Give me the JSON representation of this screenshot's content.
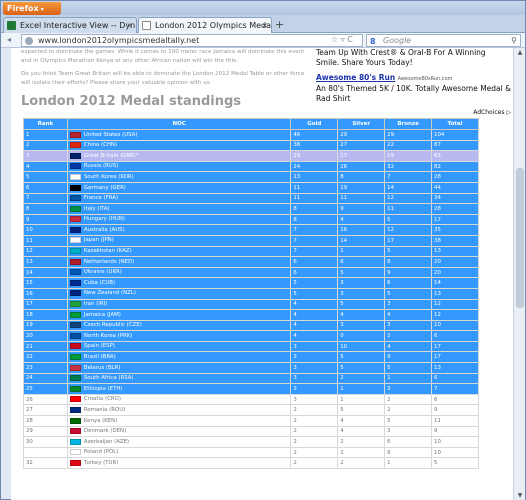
{
  "browser": {
    "app_button": "Firefox",
    "tabs": [
      {
        "title": "Excel Interactive View -- Dyn..."
      },
      {
        "title": "London 2012 Olympics Meda..."
      }
    ],
    "new_tab": "+",
    "url": "www.london2012olympicsmedaltally.net",
    "search_engine": "Google",
    "search_placeholder": "Google",
    "back": "◂",
    "star": "☆ ▿ C"
  },
  "page": {
    "intro_lines": [
      "expected to dominate the games. While it comes to 100 meter race Jamaica will dominate this event and in Olympics Marathon Kenya or any other African nation will win the title.",
      "Do you think Team Great Britain will be able to dominate the London 2012 Medal Table or other force will isolate their efforts? Please share your valuable opinion with us."
    ],
    "ad": {
      "line1": "Team Up With Crest® & Oral-B For A Winning Smile. Share Yours Today!",
      "title": "Awesome 80's Run",
      "url": "Awesome80sRun.com",
      "body": "An 80's Themed 5K / 10K. Totally Awesome Medal & Rad Shirt",
      "choices": "AdChoices ▷"
    },
    "heading": "London 2012 Medal standings",
    "table": {
      "headers": [
        "Rank",
        "NOC",
        "Gold",
        "Silver",
        "Bronze",
        "Total"
      ],
      "rows": [
        {
          "rank": "1",
          "noc": "United States (USA)",
          "gold": "46",
          "silver": "29",
          "bronze": "29",
          "total": "104",
          "style": "sel",
          "flag": "#b22234"
        },
        {
          "rank": "2",
          "noc": "China (CHN)",
          "gold": "38",
          "silver": "27",
          "bronze": "22",
          "total": "87",
          "style": "sel",
          "flag": "#de2910"
        },
        {
          "rank": "3",
          "noc": "Great Britain (GBR)*",
          "gold": "29",
          "silver": "17",
          "bronze": "19",
          "total": "65",
          "style": "hl",
          "flag": "#012169"
        },
        {
          "rank": "4",
          "noc": "Russia (RUS)",
          "gold": "24",
          "silver": "26",
          "bronze": "32",
          "total": "82",
          "style": "sel",
          "flag": "#0039a6"
        },
        {
          "rank": "5",
          "noc": "South Korea (KOR)",
          "gold": "13",
          "silver": "8",
          "bronze": "7",
          "total": "28",
          "style": "sel",
          "flag": "#ffffff"
        },
        {
          "rank": "6",
          "noc": "Germany (GER)",
          "gold": "11",
          "silver": "19",
          "bronze": "14",
          "total": "44",
          "style": "sel",
          "flag": "#000000"
        },
        {
          "rank": "7",
          "noc": "France (FRA)",
          "gold": "11",
          "silver": "11",
          "bronze": "12",
          "total": "34",
          "style": "sel",
          "flag": "#0055a4"
        },
        {
          "rank": "8",
          "noc": "Italy (ITA)",
          "gold": "8",
          "silver": "9",
          "bronze": "11",
          "total": "28",
          "style": "sel",
          "flag": "#009246"
        },
        {
          "rank": "9",
          "noc": "Hungary (HUN)",
          "gold": "8",
          "silver": "4",
          "bronze": "5",
          "total": "17",
          "style": "sel",
          "flag": "#cd2a3e"
        },
        {
          "rank": "10",
          "noc": "Australia (AUS)",
          "gold": "7",
          "silver": "16",
          "bronze": "12",
          "total": "35",
          "style": "sel",
          "flag": "#00247d"
        },
        {
          "rank": "11",
          "noc": "Japan (JPN)",
          "gold": "7",
          "silver": "14",
          "bronze": "17",
          "total": "38",
          "style": "sel",
          "flag": "#ffffff"
        },
        {
          "rank": "12",
          "noc": "Kazakhstan (KAZ)",
          "gold": "7",
          "silver": "1",
          "bronze": "5",
          "total": "13",
          "style": "sel",
          "flag": "#00afca"
        },
        {
          "rank": "13",
          "noc": "Netherlands (NED)",
          "gold": "6",
          "silver": "6",
          "bronze": "8",
          "total": "20",
          "style": "sel",
          "flag": "#ae1c28"
        },
        {
          "rank": "14",
          "noc": "Ukraine (UKR)",
          "gold": "6",
          "silver": "5",
          "bronze": "9",
          "total": "20",
          "style": "sel",
          "flag": "#0057b7"
        },
        {
          "rank": "15",
          "noc": "Cuba (CUB)",
          "gold": "5",
          "silver": "3",
          "bronze": "6",
          "total": "14",
          "style": "sel",
          "flag": "#002a8f"
        },
        {
          "rank": "16",
          "noc": "New Zealand (NZL)",
          "gold": "5",
          "silver": "3",
          "bronze": "5",
          "total": "13",
          "style": "sel",
          "flag": "#00247d"
        },
        {
          "rank": "17",
          "noc": "Iran (IRI)",
          "gold": "4",
          "silver": "5",
          "bronze": "3",
          "total": "12",
          "style": "sel",
          "flag": "#239f40"
        },
        {
          "rank": "18",
          "noc": "Jamaica (JAM)",
          "gold": "4",
          "silver": "4",
          "bronze": "4",
          "total": "12",
          "style": "sel",
          "flag": "#009b3a"
        },
        {
          "rank": "19",
          "noc": "Czech Republic (CZE)",
          "gold": "4",
          "silver": "3",
          "bronze": "3",
          "total": "10",
          "style": "sel",
          "flag": "#11457e"
        },
        {
          "rank": "20",
          "noc": "North Korea (PRK)",
          "gold": "4",
          "silver": "0",
          "bronze": "2",
          "total": "6",
          "style": "sel",
          "flag": "#024fa2"
        },
        {
          "rank": "21",
          "noc": "Spain (ESP)",
          "gold": "3",
          "silver": "10",
          "bronze": "4",
          "total": "17",
          "style": "sel",
          "flag": "#c60b1e"
        },
        {
          "rank": "22",
          "noc": "Brazil (BRA)",
          "gold": "3",
          "silver": "5",
          "bronze": "9",
          "total": "17",
          "style": "sel",
          "flag": "#009c3b"
        },
        {
          "rank": "23",
          "noc": "Belarus (BLR)",
          "gold": "3",
          "silver": "5",
          "bronze": "5",
          "total": "13",
          "style": "sel",
          "flag": "#c8313e"
        },
        {
          "rank": "24",
          "noc": "South Africa (RSA)",
          "gold": "3",
          "silver": "2",
          "bronze": "1",
          "total": "6",
          "style": "sel",
          "flag": "#007a4d"
        },
        {
          "rank": "25",
          "noc": "Ethiopia (ETH)",
          "gold": "3",
          "silver": "1",
          "bronze": "3",
          "total": "7",
          "style": "sel",
          "flag": "#078930"
        },
        {
          "rank": "26",
          "noc": "Croatia (CRO)",
          "gold": "3",
          "silver": "1",
          "bronze": "2",
          "total": "6",
          "style": "plain",
          "flag": "#ff0000"
        },
        {
          "rank": "27",
          "noc": "Romania (ROU)",
          "gold": "2",
          "silver": "5",
          "bronze": "2",
          "total": "9",
          "style": "plain",
          "flag": "#002b7f"
        },
        {
          "rank": "28",
          "noc": "Kenya (KEN)",
          "gold": "2",
          "silver": "4",
          "bronze": "5",
          "total": "11",
          "style": "plain",
          "flag": "#006600"
        },
        {
          "rank": "29",
          "noc": "Denmark (DEN)",
          "gold": "2",
          "silver": "4",
          "bronze": "3",
          "total": "9",
          "style": "plain",
          "flag": "#c60c30"
        },
        {
          "rank": "30",
          "noc": "Azerbaijan (AZE)",
          "gold": "2",
          "silver": "2",
          "bronze": "6",
          "total": "10",
          "style": "plain",
          "flag": "#00b5e2"
        },
        {
          "rank": "",
          "noc": "Poland (POL)",
          "gold": "2",
          "silver": "2",
          "bronze": "6",
          "total": "10",
          "style": "plain",
          "flag": "#ffffff"
        },
        {
          "rank": "32",
          "noc": "Turkey (TUR)",
          "gold": "2",
          "silver": "2",
          "bronze": "1",
          "total": "5",
          "style": "plain",
          "flag": "#e30a17"
        }
      ]
    }
  },
  "colors": {
    "accent": "#3399ff",
    "highlight": "#b8b8f0",
    "heading": "#9a9a9a"
  }
}
